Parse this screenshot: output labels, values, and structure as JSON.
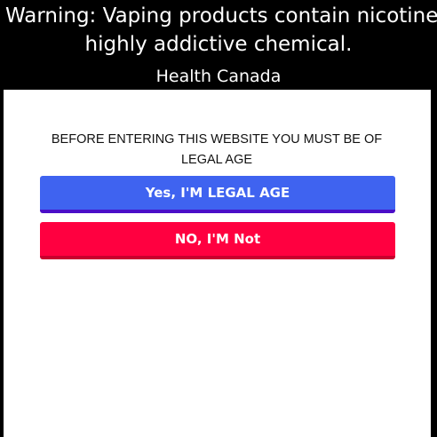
{
  "warning": {
    "line1": "Warning: Vaping products contain nicotine a",
    "line2": "highly addictive chemical.",
    "source": "Health Canada"
  },
  "age_gate": {
    "prompt": "BEFORE ENTERING THIS WEBSITE YOU MUST BE OF LEGAL AGE",
    "yes_label": "Yes, I'M LEGAL AGE",
    "no_label": "NO, I'M Not"
  },
  "colors": {
    "yes_button": "#3f63f0",
    "no_button": "#ff0040",
    "warning_bg": "#000000"
  }
}
